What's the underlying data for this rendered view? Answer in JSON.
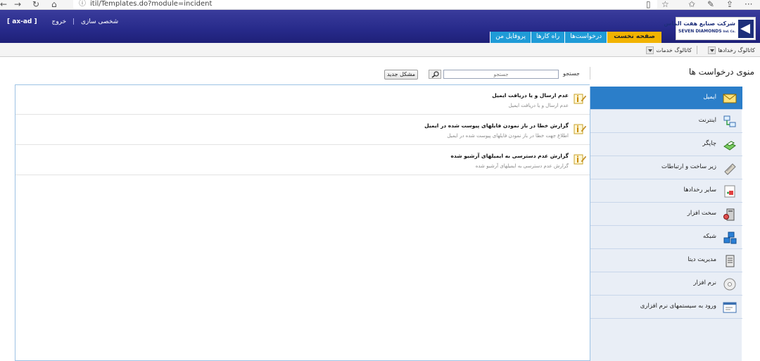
{
  "browser": {
    "url": "itil/Templates.do?module=incident",
    "back_glyph": "←",
    "forward_glyph": "→",
    "reload_glyph": "↻",
    "home_glyph": "⌂",
    "info_glyph": "ⓘ",
    "reader_glyph": "▯",
    "favorite_glyph": "☆",
    "favorites_glyph": "✩",
    "pen_glyph": "✎",
    "share_glyph": "⇪",
    "more_glyph": "···"
  },
  "header": {
    "username": "[ ax-ad ]",
    "logout": "خروج",
    "personalize": "شخصی سازی",
    "separator": "|",
    "logo_fa": "شرکت صنایع هفت الماس",
    "logo_en": "SEVEN DIAMONDS",
    "logo_en_small": "Ind. Co."
  },
  "tabs": [
    {
      "label": "صفحه نخست",
      "active": true
    },
    {
      "label": "درخواست‌ها",
      "active": false
    },
    {
      "label": "راه کارها",
      "active": false
    },
    {
      "label": "پروفایل من",
      "active": false
    }
  ],
  "catalog_bar": {
    "events_catalog": "کاتالوگ رخدادها",
    "services_catalog": "کاتالوگ خدمات"
  },
  "menu_title": "منوی درخواست ها",
  "search": {
    "label": "جستجو",
    "placeholder": "جستجو"
  },
  "new_issue_button": "مشکل جدید",
  "templates": [
    {
      "title": "عدم ارسال و یا دریافت ایمیل",
      "description": "عدم ارسال و یا دریافت ایمیل"
    },
    {
      "title": "گزارش خطا در باز نمودن فایلهای پیوست شده در ایمیل",
      "description": "اطلاع جهت خطا در باز نمودن فایلهای پیوست شده در ایمیل"
    },
    {
      "title": "گزارش عدم دسترسی به ایمیلهای آرشیو شده",
      "description": "گزارش عدم دسترسی به ایمیلهای آرشیو شده"
    }
  ],
  "sidebar": {
    "items": [
      {
        "label": "ایمیل",
        "icon": "email-icon",
        "active": true
      },
      {
        "label": "اینترنت",
        "icon": "internet-icon",
        "active": false
      },
      {
        "label": "چاپگر",
        "icon": "printer-icon",
        "active": false
      },
      {
        "label": "زیر ساخت و ارتباطات",
        "icon": "infrastructure-icon",
        "active": false
      },
      {
        "label": "سایر رخدادها",
        "icon": "other-events-icon",
        "active": false
      },
      {
        "label": "سخت افزار",
        "icon": "hardware-icon",
        "active": false
      },
      {
        "label": "شبکه",
        "icon": "network-icon",
        "active": false
      },
      {
        "label": "مدیریت دیتا",
        "icon": "data-management-icon",
        "active": false
      },
      {
        "label": "نرم افزار",
        "icon": "software-icon",
        "active": false
      },
      {
        "label": "ورود به سیستمهای نرم افزاری",
        "icon": "software-login-icon",
        "active": false
      }
    ]
  },
  "colors": {
    "header": "#272a8a",
    "active_tab": "#f2b300",
    "tab": "#1f9bd7",
    "sidebar_active": "#2b7ec9",
    "sidebar_bg": "#e9eef6"
  }
}
